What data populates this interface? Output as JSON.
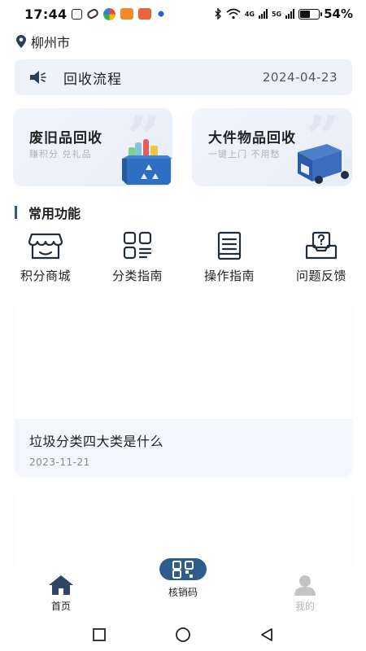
{
  "status_bar": {
    "time": "17:44",
    "battery_text": "54%",
    "battery_level": 0.54,
    "network_1": "4G",
    "network_2": "5G"
  },
  "location": {
    "city": "柳州市"
  },
  "notice": {
    "title": "回收流程",
    "date": "2024-04-23"
  },
  "cards": [
    {
      "title": "废旧品回收",
      "subtitle": "赚积分 兑礼品"
    },
    {
      "title": "大件物品回收",
      "subtitle": "一键上门 不用愁"
    }
  ],
  "section": {
    "title": "常用功能"
  },
  "functions": [
    {
      "label": "积分商城",
      "icon": "store-icon"
    },
    {
      "label": "分类指南",
      "icon": "category-guide-icon"
    },
    {
      "label": "操作指南",
      "icon": "operation-guide-icon"
    },
    {
      "label": "问题反馈",
      "icon": "feedback-icon"
    }
  ],
  "articles": [
    {
      "title": "垃圾分类四大类是什么",
      "date": "2023-11-21"
    }
  ],
  "tabbar": {
    "home_label": "首页",
    "scan_label": "核销码",
    "mine_label": "我的"
  },
  "colors": {
    "primary": "#2e5c8c",
    "card_bg": "#eef3fb",
    "inactive": "#b5b5b5"
  }
}
